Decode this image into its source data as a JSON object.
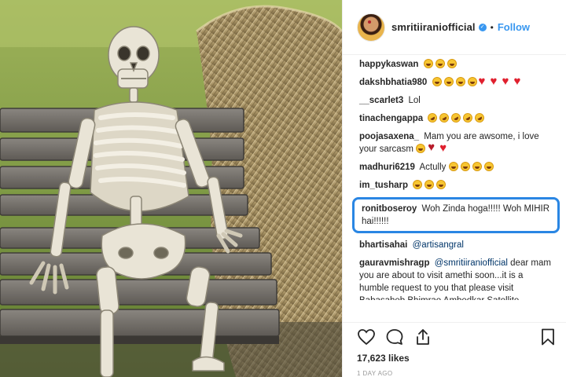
{
  "header": {
    "username": "smritiiraniofficial",
    "separator": "•",
    "follow_label": "Follow"
  },
  "comments": [
    {
      "user": "happykaswan",
      "text": "",
      "emojis": [
        "laugh",
        "laugh",
        "laugh"
      ]
    },
    {
      "user": "dakshbhatia980",
      "text": "",
      "emojis": [
        "laugh",
        "laugh",
        "laugh",
        "laugh",
        "heart",
        "heart",
        "heart",
        "heart"
      ]
    },
    {
      "user": "__scarlet3",
      "text": "Lol",
      "emojis": []
    },
    {
      "user": "tinachengappa",
      "text": "",
      "emojis": [
        "rofl",
        "rofl",
        "rofl",
        "rofl",
        "rofl"
      ]
    },
    {
      "user": "poojasaxena_",
      "text": "Mam you are awsome, i love your sarcasm",
      "emojis": [
        "laugh",
        "hearteye",
        "heart"
      ]
    },
    {
      "user": "madhuri6219",
      "text": "Actully",
      "emojis": [
        "laugh",
        "laugh",
        "laugh",
        "laugh"
      ]
    },
    {
      "user": "im_tusharp",
      "text": "",
      "emojis": [
        "laugh",
        "laugh",
        "laugh"
      ]
    },
    {
      "user": "ronitboseroy",
      "text": "Woh Zinda hoga!!!!! Woh MIHIR hai!!!!!!",
      "emojis": [],
      "highlighted": true
    },
    {
      "user": "bhartisahai",
      "text": "",
      "mention": "@artisangral",
      "emojis": []
    },
    {
      "user": "gauravmishragp",
      "text": "dear mam you are about to visit amethi soon...it is a humble request to you that please visit Babasaheb Bhimrao Ambedkar Satellite Campus ,which is shifted by you in 2016..Please it's a humble request mam . Thank you",
      "mention": "@smritiiraniofficial",
      "emojis": []
    }
  ],
  "actions": {
    "like_icon": "heart-outline-icon",
    "comment_icon": "comment-bubble-icon",
    "share_icon": "share-upload-icon",
    "save_icon": "bookmark-icon"
  },
  "likes": "17,623 likes",
  "timestamp": "1 DAY AGO",
  "colors": {
    "accent": "#3897f0",
    "highlight_border": "#2a86e3",
    "text": "#262626",
    "muted": "#999999"
  },
  "photo": {
    "subject": "skeleton-on-bench"
  }
}
